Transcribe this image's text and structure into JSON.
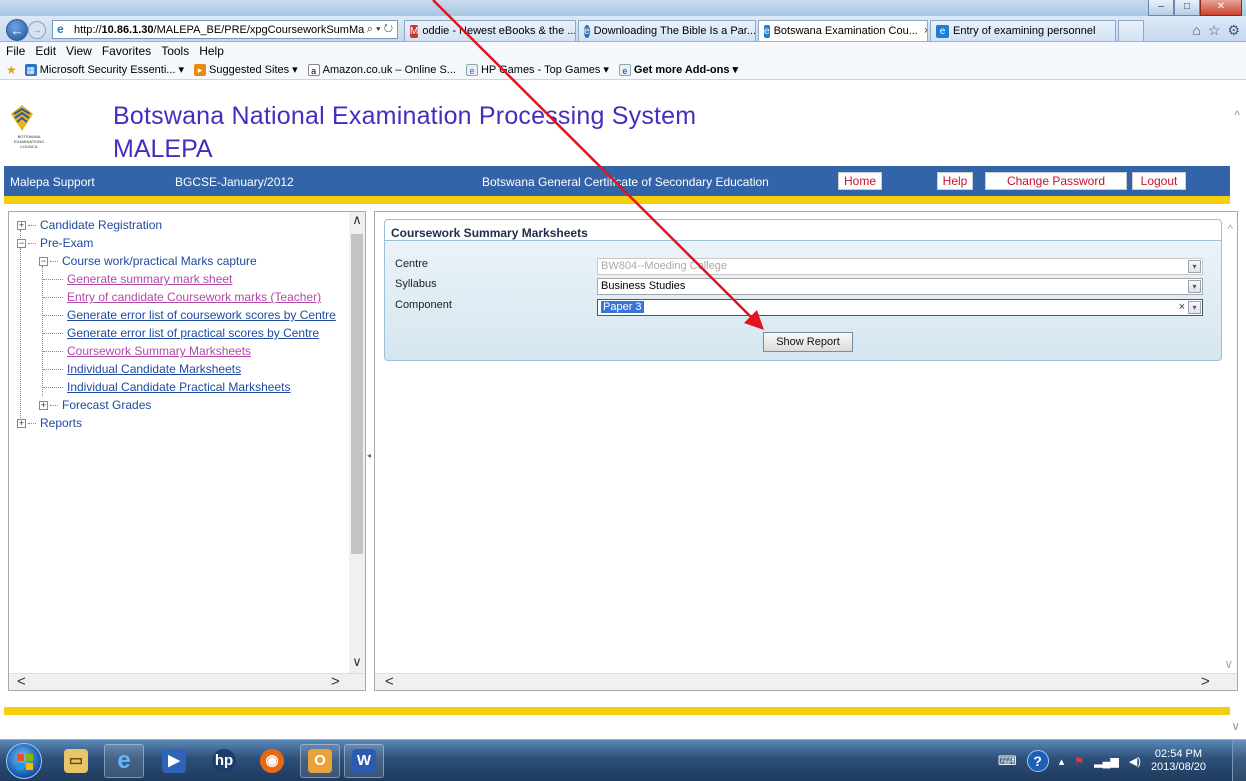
{
  "browser": {
    "address": "http://10.86.1.30/MALEPA_BE/PRE/xpgCourseworkSumMa",
    "address_host": "10.86.1.30",
    "address_prefix": "http://",
    "address_path": "/MALEPA_BE/PRE/xpgCourseworkSumMa",
    "address_actions": "⌕ ▾ ↻",
    "tabs": [
      {
        "label": "oddie - Newest eBooks & the ...",
        "icon": "gmail-icon"
      },
      {
        "label": "Downloading The Bible Is a Par...",
        "icon": "chrome-like-icon"
      },
      {
        "label": "Botswana Examination Cou...",
        "icon": "ie-icon",
        "active": true,
        "close": "×"
      },
      {
        "label": "Entry of examining personnel",
        "icon": "ie-icon"
      }
    ],
    "menu": [
      "File",
      "Edit",
      "View",
      "Favorites",
      "Tools",
      "Help"
    ],
    "favorites": [
      {
        "label": "Microsoft Security Essenti...",
        "dropdown": "▾"
      },
      {
        "label": "Suggested Sites",
        "dropdown": "▾"
      },
      {
        "label": "Amazon.co.uk – Online S..."
      },
      {
        "label": "HP Games - Top Games",
        "dropdown": "▾"
      },
      {
        "label": "Get more Add-ons",
        "dropdown": "▾"
      }
    ],
    "window_buttons": [
      "–",
      "□",
      "✕"
    ]
  },
  "header": {
    "logo_text": "BOTSWANA EXAMINATIONS COUNCIL",
    "title": "Botswana National Examination Processing System",
    "subtitle": "MALEPA"
  },
  "bluebar": {
    "support": "Malepa Support",
    "session": "BGCSE-January/2012",
    "qualification": "Botswana General Certificate of Secondary Education",
    "home": "Home",
    "help": "Help",
    "change_password": "Change Password",
    "logout": "Logout"
  },
  "tree": {
    "candidate_registration": "Candidate Registration",
    "pre_exam": "Pre-Exam",
    "coursework": "Course work/practical Marks capture",
    "items": [
      "Generate summary mark sheet",
      "Entry of candidate Coursework marks (Teacher)",
      "Generate error list of coursework scores by Centre",
      "Generate error list of practical scores by Centre",
      "Coursework Summary Marksheets",
      "Individual Candidate Marksheets",
      "Individual Candidate Practical Marksheets"
    ],
    "forecast": "Forecast Grades",
    "reports": "Reports"
  },
  "form": {
    "header": "Coursework Summary Marksheets",
    "centre_label": "Centre",
    "centre_value": "BW804--Moeding College",
    "syllabus_label": "Syllabus",
    "syllabus_value": "Business Studies",
    "component_label": "Component",
    "component_value": "Paper 3",
    "show_report": "Show Report"
  },
  "taskbar": {
    "time": "02:54 PM",
    "date": "2013/08/20"
  },
  "colors": {
    "title_purple": "#4a2bbf",
    "bluebar": "#3464a8",
    "yellow": "#f5cf0d",
    "button_red_text": "#c8102e",
    "annotation_arrow": "#e0141e"
  }
}
